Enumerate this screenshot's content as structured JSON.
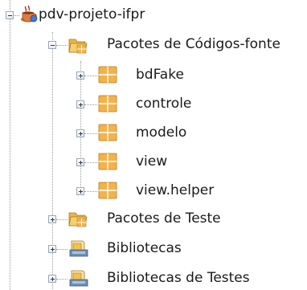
{
  "tree": {
    "project": {
      "label": "pdv-projeto-ifpr",
      "expanded": true,
      "icon": "coffee-cup-project-icon"
    },
    "source_packages": {
      "label": "Pacotes de Códigos-fonte",
      "expanded": true,
      "icon": "source-packages-folder-icon",
      "packages": [
        {
          "label": "bdFake",
          "icon": "package-icon",
          "expanded": false
        },
        {
          "label": "controle",
          "icon": "package-icon",
          "expanded": false
        },
        {
          "label": "modelo",
          "icon": "package-icon",
          "expanded": false
        },
        {
          "label": "view",
          "icon": "package-icon",
          "expanded": false
        },
        {
          "label": "view.helper",
          "icon": "package-icon",
          "expanded": false
        }
      ]
    },
    "test_packages": {
      "label": "Pacotes de Teste",
      "expanded": false,
      "icon": "test-packages-folder-icon"
    },
    "libraries": {
      "label": "Bibliotecas",
      "expanded": false,
      "icon": "libraries-icon"
    },
    "test_libraries": {
      "label": "Bibliotecas de Testes",
      "expanded": false,
      "icon": "test-libraries-icon"
    }
  },
  "colors": {
    "package_fill": "#f3b34a",
    "package_grid": "#ffffff",
    "folder_fill": "#f2c14e",
    "tree_line": "#9a9a9a",
    "text": "#1a1a1a"
  }
}
